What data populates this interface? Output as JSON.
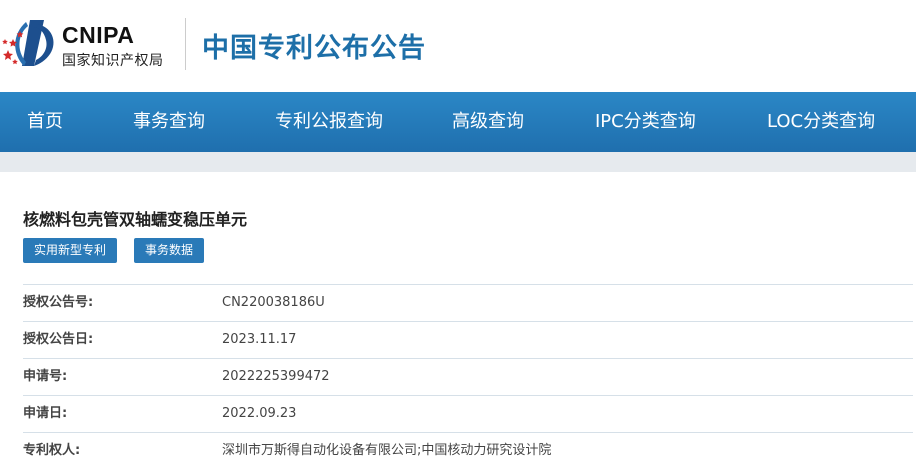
{
  "header": {
    "logo_en": "CNIPA",
    "logo_cn": "国家知识产权局",
    "site_title": "中国专利公布公告"
  },
  "nav": {
    "items": [
      "首页",
      "事务查询",
      "专利公报查询",
      "高级查询",
      "IPC分类查询",
      "LOC分类查询"
    ]
  },
  "patent": {
    "title": "核燃料包壳管双轴蠕变稳压单元",
    "tags": [
      "实用新型专利",
      "事务数据"
    ],
    "fields": [
      {
        "label": "授权公告号:",
        "value": "CN220038186U"
      },
      {
        "label": "授权公告日:",
        "value": "2023.11.17"
      },
      {
        "label": "申请号:",
        "value": "2022225399472"
      },
      {
        "label": "申请日:",
        "value": "2022.09.23"
      },
      {
        "label": "专利权人:",
        "value": "深圳市万斯得自动化设备有限公司;中国核动力研究设计院"
      }
    ]
  },
  "colors": {
    "brand_blue": "#1d6fa8",
    "nav_blue": "#2377b6",
    "tag_blue": "#2a7ab8",
    "logo_red": "#d42a2a"
  }
}
